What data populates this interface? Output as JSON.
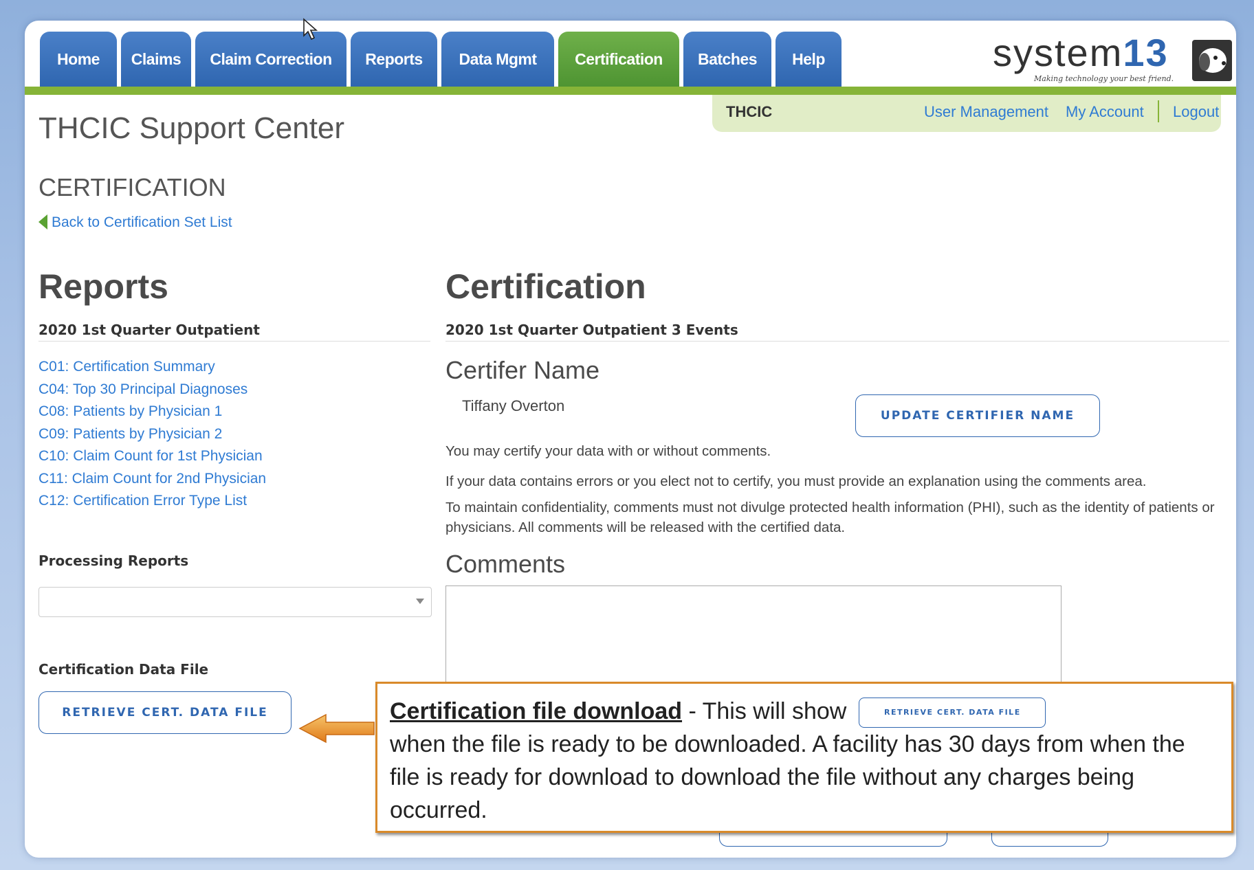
{
  "nav": {
    "tabs": [
      {
        "label": "Home"
      },
      {
        "label": "Claims"
      },
      {
        "label": "Claim Correction"
      },
      {
        "label": "Reports"
      },
      {
        "label": "Data Mgmt"
      },
      {
        "label": "Certification"
      },
      {
        "label": "Batches"
      },
      {
        "label": "Help"
      }
    ],
    "active_tab": "Certification"
  },
  "logo": {
    "word": "system",
    "number": "13",
    "tagline": "Making technology your best friend."
  },
  "subbar": {
    "org": "THCIC",
    "user_management": "User Management",
    "my_account": "My Account",
    "logout": "Logout"
  },
  "page": {
    "site_title": "THCIC Support Center",
    "section_title": "CERTIFICATION",
    "back_link": "Back to Certification Set List"
  },
  "reports": {
    "title": "Reports",
    "subtitle": "2020 1st Quarter Outpatient",
    "links": [
      "C01: Certification Summary",
      "C04: Top 30 Principal Diagnoses",
      "C08: Patients by Physician 1",
      "C09: Patients by Physician 2",
      "C10: Claim Count for 1st Physician",
      "C11: Claim Count for 2nd Physician",
      "C12: Certification Error Type List"
    ],
    "processing_label": "Processing Reports",
    "processing_value": "",
    "data_file_label": "Certification Data File",
    "retrieve_button": "RETRIEVE CERT. DATA FILE"
  },
  "certification": {
    "title": "Certification",
    "subtitle": "2020 1st Quarter Outpatient 3 Events",
    "certifier_heading": "Certifer Name",
    "certifier_name": "Tiffany Overton",
    "update_button": "UPDATE CERTIFIER NAME",
    "para1": "You may certify your data with or without comments.",
    "para2": "If your data contains errors or you elect not to certify, you must provide an explanation using the comments area.",
    "para3": "To maintain confidentiality, comments must not divulge protected health information (PHI), such as the identity of patients or physicians. All comments will be released with the certified data.",
    "comments_heading": "Comments",
    "comments_value": ""
  },
  "callout": {
    "heading": "Certification file download",
    "lead": " - This will show",
    "button": "RETRIEVE CERT. DATA FILE",
    "body": "when the file is ready to be downloaded. A facility has 30 days from when the file is ready for download to download the file without any charges being occurred."
  },
  "colors": {
    "nav_blue": "#2f66b0",
    "nav_active_green": "#5aa232",
    "accent_bar": "#86b438",
    "link": "#2f7bd3",
    "callout_border": "#d98a2a"
  }
}
